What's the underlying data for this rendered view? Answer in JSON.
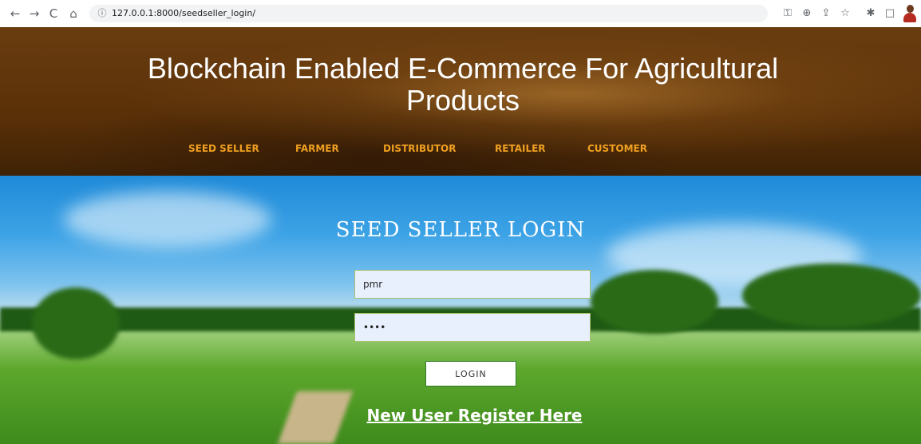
{
  "browser": {
    "url": "127.0.0.1:8000/seedseller_login/",
    "back_icon": "←",
    "forward_icon": "→",
    "reload_icon": "C",
    "home_icon": "⌂",
    "info_icon": "ⓘ",
    "key_icon": "⚿",
    "zoom_icon": "⊕",
    "share_icon": "⇪",
    "star_icon": "☆",
    "extensions_icon": "✱",
    "window_icon": "□"
  },
  "header": {
    "title": "Blockchain Enabled E-Commerce For Agricultural Products",
    "nav": [
      {
        "label": "SEED SELLER"
      },
      {
        "label": "FARMER"
      },
      {
        "label": "DISTRIBUTOR"
      },
      {
        "label": "RETAILER"
      },
      {
        "label": "CUSTOMER"
      }
    ]
  },
  "login": {
    "title": "SEED SELLER LOGIN",
    "username_value": "pmr",
    "password_value": "••••",
    "button_label": "LOGIN",
    "register_link": "New User Register Here"
  },
  "colors": {
    "nav_link": "#f0a020",
    "header_bg": "#5a3008",
    "button_border": "#2f7a2a",
    "input_bg": "#e8f0fe"
  }
}
